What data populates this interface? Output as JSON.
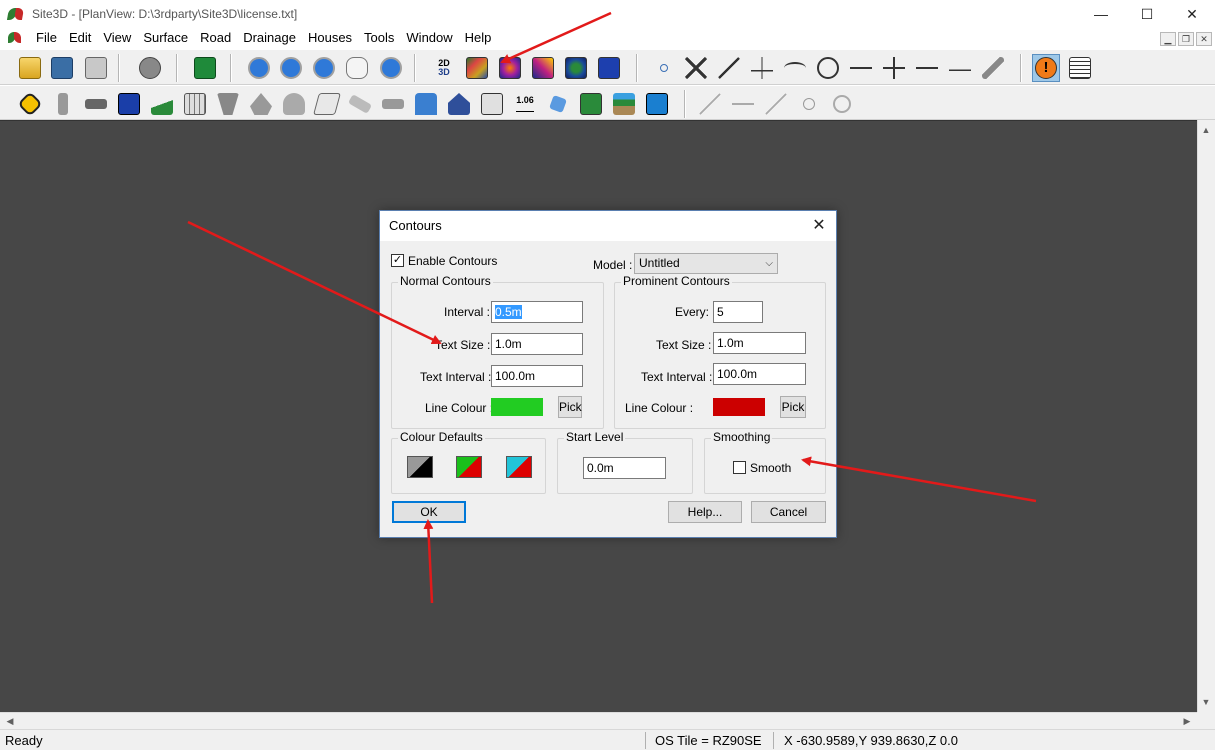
{
  "window": {
    "title": "Site3D - [PlanView: D:\\3rdparty\\Site3D\\license.txt]",
    "controls": {
      "minimize": "—",
      "maximize": "☐",
      "close": "✕"
    }
  },
  "menu": {
    "items": [
      "File",
      "Edit",
      "View",
      "Surface",
      "Road",
      "Drainage",
      "Houses",
      "Tools",
      "Window",
      "Help"
    ],
    "mdi": {
      "minimize": "▁",
      "restore": "❐",
      "close": "✕"
    }
  },
  "toolbar": {
    "view_2d3d": {
      "top": "2D",
      "bottom": "3D"
    },
    "level_label": "1.06"
  },
  "statusbar": {
    "ready": "Ready",
    "os_tile": "OS Tile = RZ90SE",
    "coords": "X -630.9589,Y 939.8630,Z 0.0"
  },
  "dialog": {
    "title": "Contours",
    "close": "✕",
    "enable_contours": {
      "label": "Enable Contours",
      "checked": "✓"
    },
    "model": {
      "label": "Model :",
      "value": "Untitled"
    },
    "normal": {
      "title": "Normal Contours",
      "interval_label": "Interval :",
      "interval_value": "0.5m",
      "text_size_label": "Text Size :",
      "text_size_value": "1.0m",
      "text_interval_label": "Text Interval :",
      "text_interval_value": "100.0m",
      "line_colour_label": "Line Colour :",
      "line_colour": "#22cc22",
      "pick_label": "Pick"
    },
    "prominent": {
      "title": "Prominent Contours",
      "every_label": "Every:",
      "every_value": "5",
      "text_size_label": "Text Size :",
      "text_size_value": "1.0m",
      "text_interval_label": "Text Interval :",
      "text_interval_value": "100.0m",
      "line_colour_label": "Line Colour :",
      "line_colour": "#cc0000",
      "pick_label": "Pick"
    },
    "colour_defaults": {
      "title": "Colour Defaults"
    },
    "start_level": {
      "title": "Start Level",
      "value": "0.0m"
    },
    "smoothing": {
      "title": "Smoothing",
      "smooth_label": "Smooth"
    },
    "buttons": {
      "ok": "OK",
      "help": "Help...",
      "cancel": "Cancel"
    }
  }
}
